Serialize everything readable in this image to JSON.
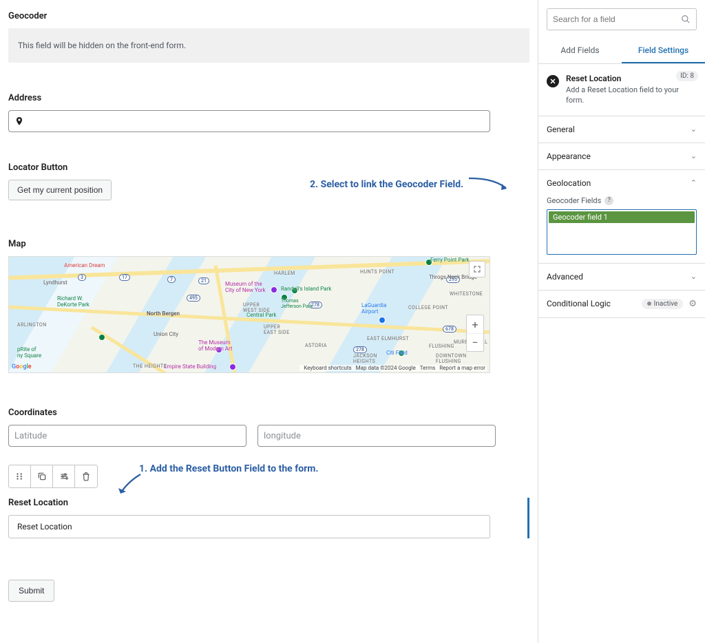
{
  "form": {
    "geocoder": {
      "label": "Geocoder",
      "notice": "This field will be hidden on the front-end form."
    },
    "address": {
      "label": "Address"
    },
    "locator": {
      "label": "Locator Button",
      "button": "Get my current position"
    },
    "map": {
      "label": "Map",
      "places": {
        "american_dream": "American Dream",
        "lyndhurst": "Lyndhurst",
        "dekorte": "Richard W.\nDeKorte Park",
        "north_bergen": "North Bergen",
        "union_city": "Union City",
        "prite": "pRite of\nny Square",
        "museum_ny": "Museum of the\nCity of New York",
        "jefferson": "Thomas\nJefferson Park",
        "moma": "The Museum\nof Modern Art",
        "central_park": "Central Park",
        "randalls": "Randall's Island Park",
        "laguardia": "LaGuardia\nAirport",
        "citi": "Citi Field",
        "empire": "Empire State Building",
        "throgs": "Throgs Neck Bridge",
        "ferry": "Ferry Point Park"
      },
      "neighborhoods": {
        "harlem": "HARLEM",
        "arlington": "ARLINGTON",
        "heights": "THE HEIGHTS",
        "uws": "UPPER\nWEST SIDE",
        "ues": "UPPER\nEAST SIDE",
        "astoria": "ASTORIA",
        "hunts": "HUNTS POINT",
        "elmhurst": "EAST ELMHURST",
        "flushing": "FLUSHING",
        "whitestone": "WHITESTONE",
        "college": "COLLEGE POINT",
        "murray": "MURRAY HILL",
        "jackson": "JACKSON\nHEIGHTS",
        "downtown_flushing": "DOWNTOWN\nFLUSHING"
      },
      "routes": {
        "r3": "3",
        "r17": "17",
        "r7": "7",
        "r21": "21",
        "r495": "495",
        "r278a": "278",
        "r278b": "278",
        "r295": "295",
        "r678": "678"
      },
      "attribution": {
        "shortcuts": "Keyboard shortcuts",
        "data": "Map data ©2024 Google",
        "terms": "Terms",
        "report": "Report a map error"
      }
    },
    "coordinates": {
      "label": "Coordinates",
      "lat_placeholder": "Latitude",
      "lng_placeholder": "longitude"
    },
    "reset": {
      "label": "Reset Location",
      "row_text": "Reset Location"
    },
    "submit": "Submit"
  },
  "annotations": {
    "step1": "1. Add the Reset Button Field to the form.",
    "step2": "2. Select to link the Geocoder Field."
  },
  "sidebar": {
    "search_placeholder": "Search for a field",
    "tabs": {
      "add": "Add Fields",
      "settings": "Field Settings"
    },
    "field": {
      "title": "Reset Location",
      "desc": "Add a Reset Location field to your form.",
      "id": "ID: 8"
    },
    "sections": {
      "general": "General",
      "appearance": "Appearance",
      "geolocation": "Geolocation",
      "advanced": "Advanced"
    },
    "geolocation": {
      "sub_label": "Geocoder Fields",
      "option": "Geocoder field 1"
    },
    "cond": {
      "label": "Conditional Logic",
      "status": "Inactive"
    }
  }
}
